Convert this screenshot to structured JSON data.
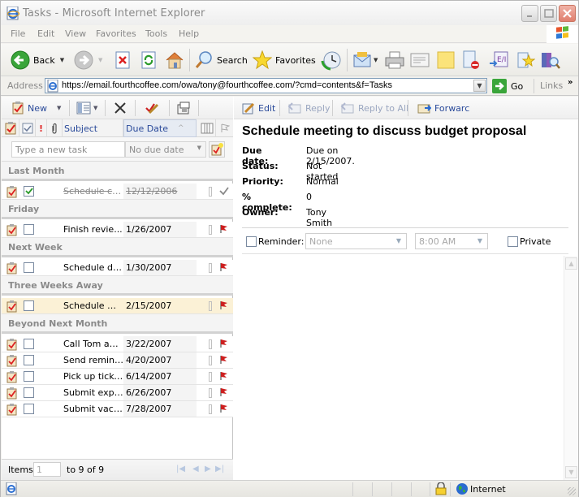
{
  "window": {
    "title": "Tasks - Microsoft Internet Explorer"
  },
  "menu": [
    "File",
    "Edit",
    "View",
    "Favorites",
    "Tools",
    "Help"
  ],
  "toolbar": {
    "back_label": "Back",
    "search_label": "Search",
    "favorites_label": "Favorites"
  },
  "address": {
    "label": "Address",
    "url": "https://email.fourthcoffee.com/owa/tony@fourthcoffee.com/?cmd=contents&f=Tasks",
    "go_label": "Go",
    "links_label": "Links",
    "links_chevron": "»"
  },
  "tasks_toolbar": {
    "new_label": "New"
  },
  "columns": {
    "subject": "Subject",
    "due_date": "Due Date",
    "sort_indicator": "^"
  },
  "new_task": {
    "placeholder": "Type a new task",
    "due_placeholder": "No due date"
  },
  "groups": [
    {
      "label": "Last Month",
      "tasks": [
        {
          "subject": "Schedule ca...",
          "due": "12/12/2006",
          "completed": true,
          "selected": false
        }
      ]
    },
    {
      "label": "Friday",
      "tasks": [
        {
          "subject": "Finish revie...",
          "due": "1/26/2007",
          "completed": false,
          "selected": false
        }
      ]
    },
    {
      "label": "Next Week",
      "tasks": [
        {
          "subject": "Schedule do...",
          "due": "1/30/2007",
          "completed": false,
          "selected": false
        }
      ]
    },
    {
      "label": "Three Weeks Away",
      "tasks": [
        {
          "subject": "Schedule me...",
          "due": "2/15/2007",
          "completed": false,
          "selected": true
        }
      ]
    },
    {
      "label": "Beyond Next Month",
      "tasks": [
        {
          "subject": "Call Tom ab...",
          "due": "3/22/2007",
          "completed": false,
          "selected": false
        },
        {
          "subject": "Send remind...",
          "due": "4/20/2007",
          "completed": false,
          "selected": false
        },
        {
          "subject": "Pick up ticke...",
          "due": "6/14/2007",
          "completed": false,
          "selected": false
        },
        {
          "subject": "Submit expe...",
          "due": "6/26/2007",
          "completed": false,
          "selected": false
        },
        {
          "subject": "Submit vaca...",
          "due": "7/28/2007",
          "completed": false,
          "selected": false
        }
      ]
    }
  ],
  "pager": {
    "items_label": "Items",
    "page_value": "1",
    "range_text": "to 9 of 9"
  },
  "reading_toolbar": {
    "edit_label": "Edit",
    "reply_label": "Reply",
    "reply_all_label": "Reply to All",
    "forward_label": "Forwarc"
  },
  "task_detail": {
    "subject": "Schedule meeting to discuss budget proposal",
    "fields": [
      {
        "label": "Due date:",
        "value": "Due on 2/15/2007."
      },
      {
        "label": "Status:",
        "value": "Not started"
      },
      {
        "label": "Priority:",
        "value": "Normal"
      },
      {
        "label": "% complete:",
        "value": "0"
      },
      {
        "label": "Owner:",
        "value": "Tony Smith"
      }
    ],
    "reminder_label": "Reminder:",
    "reminder_date": "None",
    "reminder_time": "8:00 AM",
    "private_label": "Private"
  },
  "status": {
    "zone": "Internet"
  },
  "colors": {
    "link_blue": "#2a4a9a",
    "selected_row": "#fbf1d6",
    "flag_red": "#cc1f1f",
    "group_text": "#8a8a8a"
  }
}
